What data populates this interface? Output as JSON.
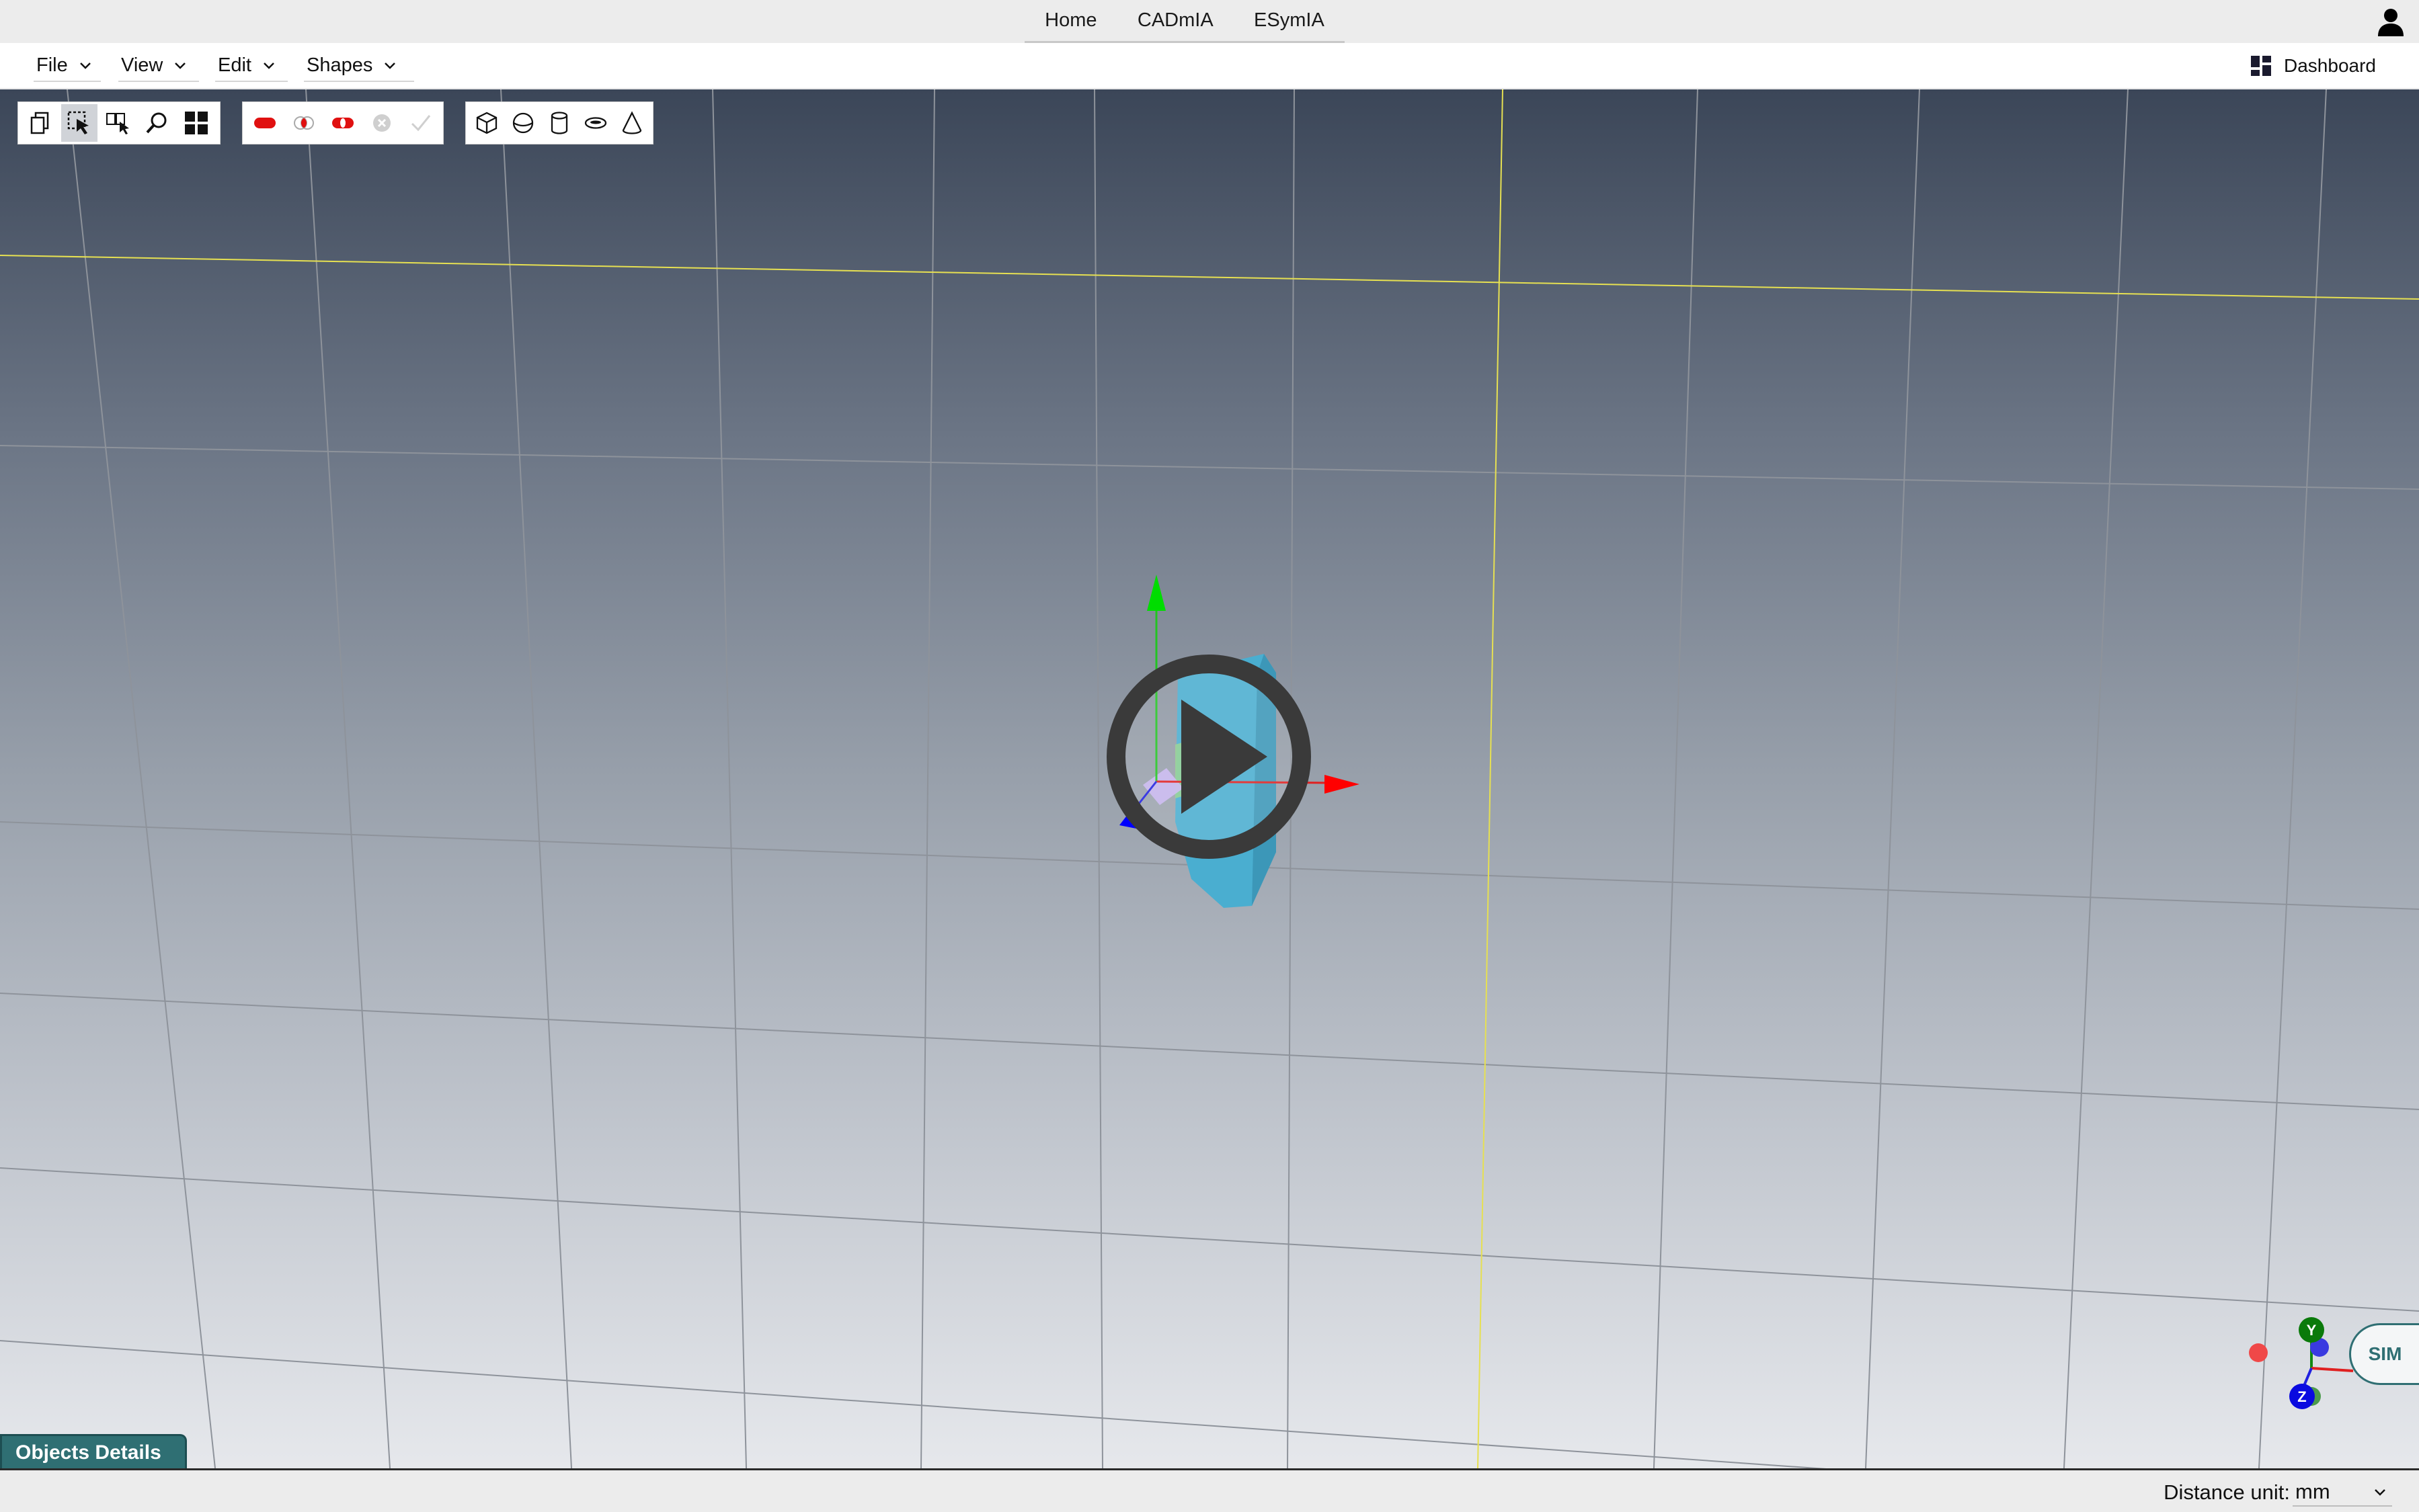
{
  "topnav": {
    "home": "Home",
    "cadmia": "CADmIA",
    "esymia": "ESymIA"
  },
  "menubar": {
    "file": "File",
    "view": "View",
    "edit": "Edit",
    "shapes": "Shapes",
    "dashboard": "Dashboard"
  },
  "toolbar": {
    "groups": [
      {
        "name": "transform-tools",
        "items": [
          "copy-icon",
          "select-icon",
          "multi-select-icon",
          "zoom-icon",
          "grid-view-icon"
        ],
        "active": "select-icon"
      },
      {
        "name": "boolean-tools",
        "items": [
          "union-icon",
          "intersection-icon",
          "difference-icon",
          "cancel-icon",
          "confirm-icon"
        ]
      },
      {
        "name": "primitive-tools",
        "items": [
          "cube-icon",
          "sphere-icon",
          "cylinder-icon",
          "torus-icon",
          "cone-icon"
        ]
      }
    ]
  },
  "gizmo": {
    "y": "Y",
    "z": "Z"
  },
  "sim_button": "SIM",
  "objects_details": "Objects Details",
  "statusbar": {
    "distance_label": "Distance unit:",
    "distance_value": "mm"
  },
  "colors": {
    "accent": "#2f6f73",
    "axis_x": "#ff0000",
    "axis_y": "#00cc00",
    "axis_z": "#0000ff",
    "object": "#4aaed0",
    "grid_axis": "#e6e052"
  }
}
